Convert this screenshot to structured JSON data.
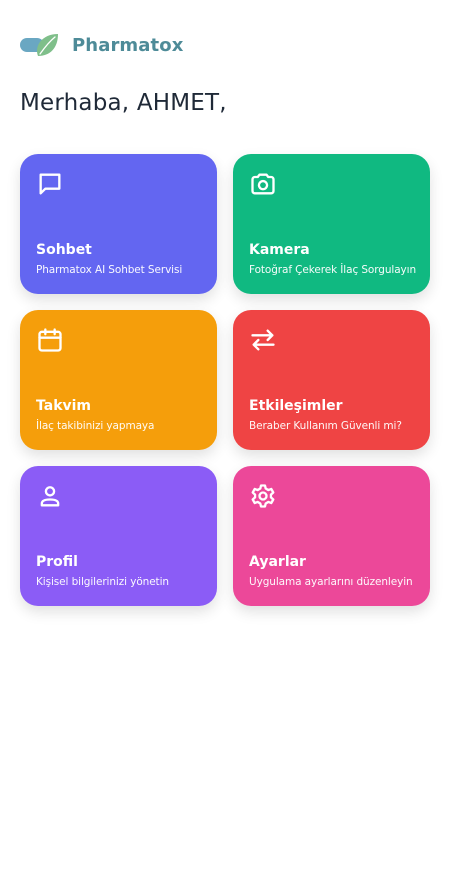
{
  "brand": {
    "name": "Pharmatox",
    "logo_icon": "leaf-capsule-logo-icon"
  },
  "greeting": "Merhaba, AHMET,",
  "cards": [
    {
      "title": "Sohbet",
      "subtitle": "Pharmatox AI Sohbet Servisi",
      "icon": "chat-icon",
      "color": "#6366f1"
    },
    {
      "title": "Kamera",
      "subtitle": "Fotoğraf Çekerek İlaç Sorgulayın",
      "icon": "camera-icon",
      "color": "#10b981"
    },
    {
      "title": "Takvim",
      "subtitle": "İlaç takibinizi yapmaya",
      "icon": "calendar-icon",
      "color": "#f59e0b"
    },
    {
      "title": "Etkileşimler",
      "subtitle": "Beraber Kullanım Güvenli mi?",
      "icon": "arrows-exchange-icon",
      "color": "#ef4444"
    },
    {
      "title": "Profil",
      "subtitle": "Kişisel bilgilerinizi yönetin",
      "icon": "user-icon",
      "color": "#8b5cf6"
    },
    {
      "title": "Ayarlar",
      "subtitle": "Uygulama ayarlarını düzenleyin",
      "icon": "gear-icon",
      "color": "#ec4899"
    }
  ]
}
